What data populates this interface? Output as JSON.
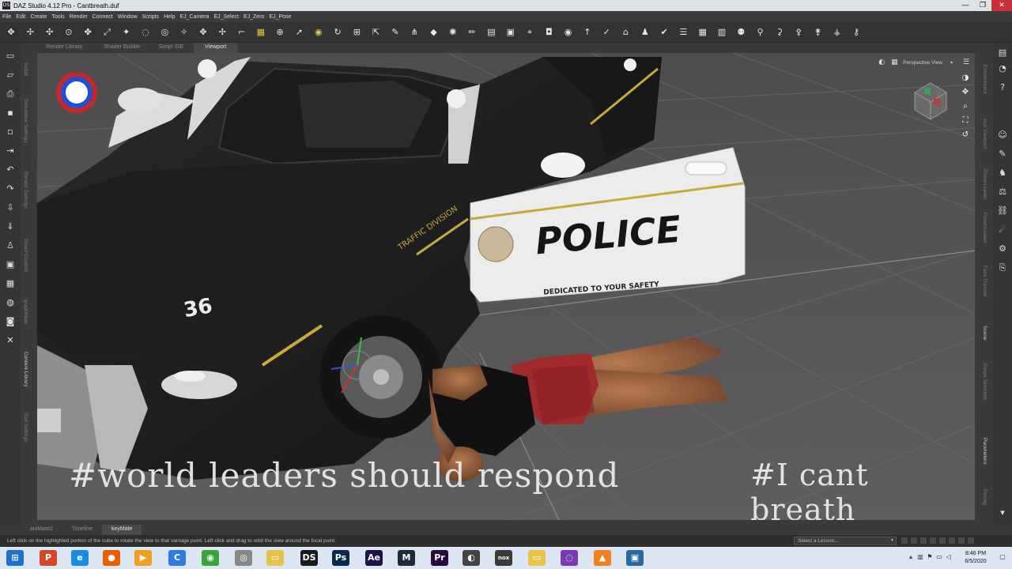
{
  "window": {
    "title": "DAZ Studio 4.12 Pro - Cantbreath.duf",
    "app_icon": "DS",
    "minimize": "—",
    "maximize": "❐",
    "close": "✕"
  },
  "menu": [
    "File",
    "Edit",
    "Create",
    "Tools",
    "Render",
    "Connect",
    "Window",
    "Scripts",
    "Help",
    "EJ_Camera",
    "EJ_Select",
    "EJ_Zero",
    "EJ_Pose"
  ],
  "toolbar_icons": [
    "node-selection-icon",
    "universal-tool-icon",
    "joint-editor-icon",
    "rotate-icon",
    "translate-icon",
    "scale-icon",
    "node-weight-icon",
    "geometry-editor-icon",
    "surface-selection-icon",
    "pose-tool-icon",
    "region-navigator-icon",
    "active-pose-icon",
    "transform-icon",
    "camera-orbit-icon",
    "pointer-icon",
    "spot-render-icon",
    "rotate-view-icon",
    "move-view-icon",
    "scale-view-icon",
    "morph-icon",
    "bend-icon",
    "geometry-sculptor-icon",
    "light-icon",
    "brush-icon",
    "shader-icon",
    "lock-icon",
    "camera-icon",
    "eye-icon",
    "up-arrow-icon",
    "pin-icon",
    "hat-icon",
    "check-icon",
    "list-icon",
    "grid-icon",
    "layout-icon",
    "figure-icon",
    "pose-icon",
    "arrow-icon",
    "run-icon",
    "jump-icon",
    "walk-icon",
    "dance-icon"
  ],
  "top_tabs": [
    "Render Library",
    "Shader Builder",
    "Script IDE",
    "Viewport"
  ],
  "left_panel_tabs": [
    "Install",
    "Simulation Settings",
    "Render Settings",
    "Smart Content",
    "graphMate",
    "Content Library",
    "Tool Settings"
  ],
  "right_panel_tabs": [
    "Environment",
    "Aux Viewport",
    "PowerLoader",
    "Face Transfer",
    "Scene",
    "Shape Selection",
    "Parameters",
    "Posing"
  ],
  "viewport": {
    "camera_label": "Perspective View",
    "dropdown_arrow": "▾",
    "caption_left": "#world leaders should respond",
    "caption_right": "#I cant breath",
    "car_text": "POLICE",
    "car_slogan": "DEDICATED TO YOUR SAFETY",
    "car_division": "TRAFFIC DIVISION",
    "car_number": "36"
  },
  "timeline_tabs": [
    "aniMate2",
    "Timeline",
    "keyMate"
  ],
  "status": {
    "text": "Left click on the highlighted portion of the cube to rotate the view to that vantage point. Left click and drag to orbit the view around the focal point.",
    "lesson_placeholder": "Select a Lesson...",
    "lesson_arrow": "▾"
  },
  "taskbar": {
    "time": "8:46 PM",
    "date": "6/5/2020",
    "apps": [
      {
        "name": "start-button",
        "glyph": "⊞",
        "color": "#1e6fd0"
      },
      {
        "name": "powerpoint-app",
        "glyph": "P",
        "color": "#d24726"
      },
      {
        "name": "ie-app",
        "glyph": "e",
        "color": "#1a8de0"
      },
      {
        "name": "firefox-app",
        "glyph": "●",
        "color": "#e66000"
      },
      {
        "name": "media-player-app",
        "glyph": "▶",
        "color": "#f0a020"
      },
      {
        "name": "ccleaner-app",
        "glyph": "C",
        "color": "#2d7be0"
      },
      {
        "name": "chrome-app",
        "glyph": "◉",
        "color": "#3aa43a"
      },
      {
        "name": "settings-app",
        "glyph": "◎",
        "color": "#888888"
      },
      {
        "name": "explorer-app",
        "glyph": "▭",
        "color": "#e8c34a"
      },
      {
        "name": "daz-studio-app",
        "glyph": "DS",
        "color": "#1b1b1b"
      },
      {
        "name": "photoshop-app",
        "glyph": "Ps",
        "color": "#0b2a4a"
      },
      {
        "name": "after-effects-app",
        "glyph": "Ae",
        "color": "#1f1446"
      },
      {
        "name": "maya-app",
        "glyph": "M",
        "color": "#1d2b34"
      },
      {
        "name": "premiere-app",
        "glyph": "Pr",
        "color": "#2a0a3e"
      },
      {
        "name": "steam-app",
        "glyph": "◐",
        "color": "#444444"
      },
      {
        "name": "nox-app",
        "glyph": "nox",
        "color": "#3a3a3a"
      },
      {
        "name": "folder-app",
        "glyph": "▭",
        "color": "#e8c34a"
      },
      {
        "name": "browser-app",
        "glyph": "◌",
        "color": "#7a3ab0"
      },
      {
        "name": "vlc-app",
        "glyph": "▲",
        "color": "#f08020"
      },
      {
        "name": "display-app",
        "glyph": "▣",
        "color": "#2a6aa0"
      }
    ]
  },
  "colors": {
    "accent_highlight": "#e6c93a",
    "close_button": "#c8303a",
    "viewport_bg": "#545454"
  }
}
